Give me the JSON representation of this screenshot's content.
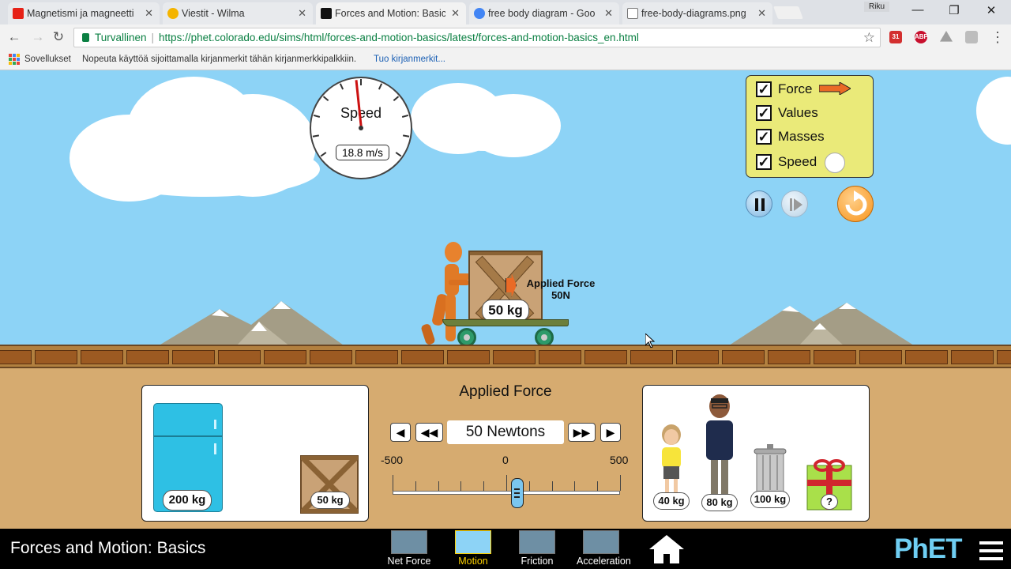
{
  "tabs": [
    {
      "title": "Magnetismi ja magneetti",
      "favicon_color": "#e62117",
      "icon": "youtube-icon"
    },
    {
      "title": "Viestit - Wilma",
      "favicon_color": "#f4b400",
      "icon": "wilma-icon"
    },
    {
      "title": "Forces and Motion: Basic",
      "favicon_color": "#111111",
      "icon": "phet-icon",
      "active": true
    },
    {
      "title": "free body diagram - Goo",
      "favicon_color": "#4285f4",
      "icon": "google-icon"
    },
    {
      "title": "free-body-diagrams.png",
      "favicon_color": "#ffffff",
      "icon": "file-icon"
    }
  ],
  "window": {
    "user": "Riku"
  },
  "address": {
    "secure_label": "Turvallinen",
    "url": "https://phet.colorado.edu/sims/html/forces-and-motion-basics/latest/forces-and-motion-basics_en.html"
  },
  "bookmarks": {
    "apps_label": "Sovellukset",
    "hint": "Nopeuta käyttöä sijoittamalla kirjanmerkit tähän kirjanmerkkipalkkiin.",
    "link": "Tuo kirjanmerkit..."
  },
  "speedometer": {
    "title": "Speed",
    "readout": "18.8 m/s"
  },
  "options": [
    {
      "label": "Force",
      "checked": true
    },
    {
      "label": "Values",
      "checked": true
    },
    {
      "label": "Masses",
      "checked": true
    },
    {
      "label": "Speed",
      "checked": true
    }
  ],
  "scene": {
    "crate_mass": "50 kg",
    "applied_force_label": "Applied Force",
    "applied_force_value": "50N"
  },
  "left_box": {
    "fridge": "200 kg",
    "crate": "50 kg"
  },
  "applied": {
    "title": "Applied Force",
    "value": "50 Newtons",
    "min": "-500",
    "zero": "0",
    "max": "500",
    "current": 50
  },
  "right_box": {
    "girl": "40 kg",
    "man": "80 kg",
    "trash": "100 kg",
    "gift": "?"
  },
  "footer": {
    "title": "Forces and Motion: Basics",
    "screens": [
      {
        "label": "Net Force"
      },
      {
        "label": "Motion",
        "selected": true
      },
      {
        "label": "Friction"
      },
      {
        "label": "Acceleration"
      }
    ],
    "logo": "PhET"
  },
  "colors": {
    "sky": "#8dd3f6",
    "ground": "#d6ab70",
    "panel": "#eaea79",
    "accent_orange": "#f7941d",
    "selected_tab": "#ffd200",
    "secure_green": "#0b8043"
  }
}
